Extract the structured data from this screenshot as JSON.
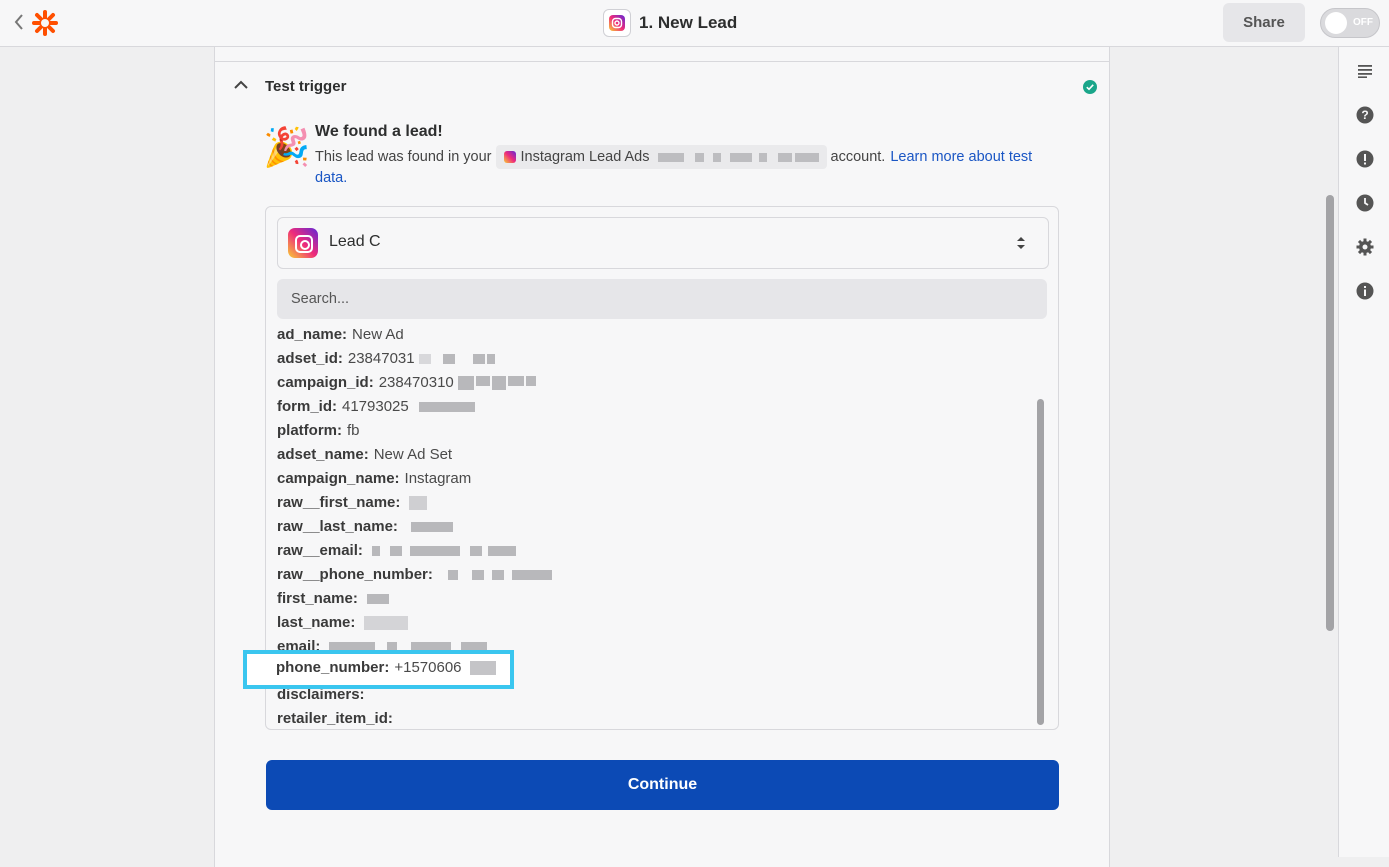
{
  "header": {
    "title": "1. New Lead",
    "share_label": "Share",
    "toggle_label": "OFF"
  },
  "section": {
    "title": "Test trigger"
  },
  "found": {
    "title": "We found a lead!",
    "text_before": "This lead was found in your",
    "account_app": "Instagram Lead Ads",
    "text_after": "account.",
    "link_part1": "Learn more about test",
    "link_part2": "data."
  },
  "lead": {
    "selected": "Lead C",
    "search_placeholder": "Search..."
  },
  "fields": [
    {
      "key": "ad_name:",
      "value": "New Ad"
    },
    {
      "key": "adset_id:",
      "value": "23847031"
    },
    {
      "key": "campaign_id:",
      "value": "238470310"
    },
    {
      "key": "form_id:",
      "value": "41793025"
    },
    {
      "key": "platform:",
      "value": "fb"
    },
    {
      "key": "adset_name:",
      "value": "New Ad Set"
    },
    {
      "key": "campaign_name:",
      "value": "Instagram"
    },
    {
      "key": "raw__first_name:",
      "value": ""
    },
    {
      "key": "raw__last_name:",
      "value": ""
    },
    {
      "key": "raw__email:",
      "value": ""
    },
    {
      "key": "raw__phone_number:",
      "value": ""
    },
    {
      "key": "first_name:",
      "value": ""
    },
    {
      "key": "last_name:",
      "value": ""
    },
    {
      "key": "email:",
      "value": ""
    },
    {
      "key": "phone_number:",
      "value": "+1570606"
    },
    {
      "key": "disclaimers:",
      "value": ""
    },
    {
      "key": "retailer_item_id:",
      "value": ""
    }
  ],
  "continue_label": "Continue",
  "colors": {
    "primary": "#0c4ab5",
    "highlight": "#3ac6ef",
    "success": "#1aa68a",
    "brand": "#ff4f00"
  }
}
